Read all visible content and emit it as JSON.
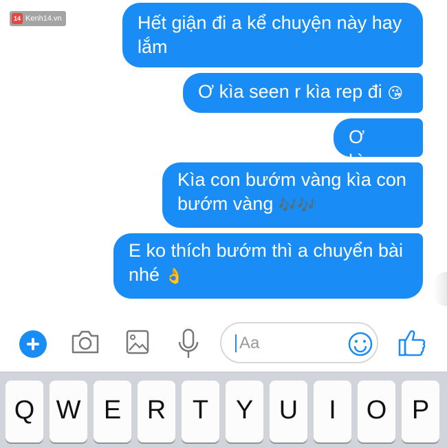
{
  "watermark": {
    "logo": "14",
    "text": "Kenh14.vn"
  },
  "messages": [
    {
      "text": "Hết giận đi a kể chuyện này hay lắm"
    },
    {
      "text": "Ơ kìa seen r kìa rep đi",
      "emoji": "😘"
    },
    {
      "text": "Ơ kìa..."
    },
    {
      "text": "Kìa con bướm vàng kìa con bướm vàng",
      "emoji": "🎶🎶"
    },
    {
      "text": "E ko thích bướm thì a chuyển bài nhé",
      "emoji": "👌"
    }
  ],
  "composer": {
    "placeholder": "Aa",
    "icons": [
      "plus-icon",
      "camera-icon",
      "image-icon",
      "microphone-icon",
      "smiley-icon",
      "thumbs-up-icon"
    ]
  },
  "keyboard": {
    "row1": [
      "Q",
      "W",
      "E",
      "R",
      "T",
      "Y",
      "U",
      "I",
      "O",
      "P"
    ]
  },
  "colors": {
    "bubble": "#1a8cf5",
    "accent": "#1a8cf5",
    "keyboard_bg": "#d1d4db"
  }
}
